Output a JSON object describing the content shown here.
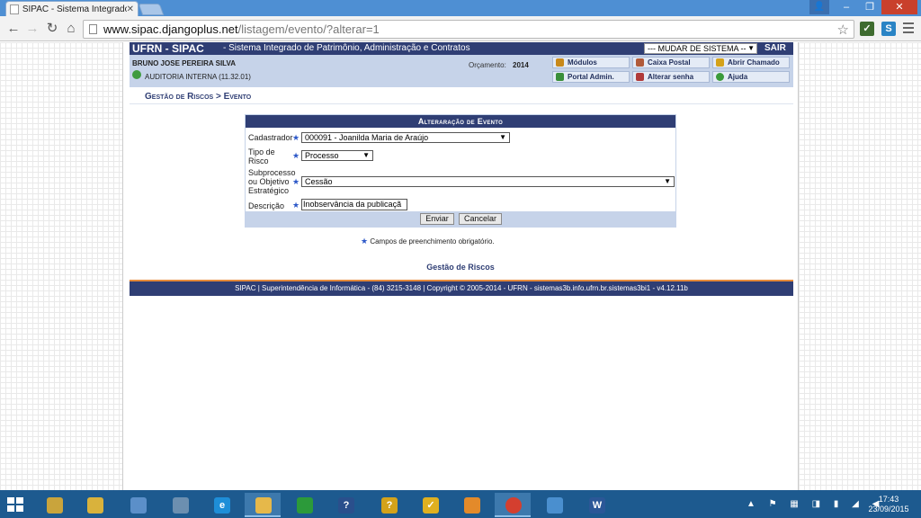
{
  "browser": {
    "tab_title": "SIPAC - Sistema Integrado",
    "url_host": "www.sipac.djangoplus.net",
    "url_path": "/listagem/evento/?alterar=1"
  },
  "header": {
    "logo": "UFRN - SIPAC",
    "system_name": "- Sistema Integrado de Patrimônio, Administração e Contratos",
    "system_select": "--- MUDAR DE SISTEMA --",
    "sair": "SAIR"
  },
  "user": {
    "name": "BRUNO JOSE PEREIRA SILVA",
    "unit": "AUDITORIA INTERNA (11.32.01)",
    "orcamento_label": "Orçamento:",
    "orcamento_value": "2014"
  },
  "quick_links": [
    {
      "label": "Módulos",
      "icon": "modules-icon",
      "color": "#c8891b"
    },
    {
      "label": "Caixa Postal",
      "icon": "mailbox-icon",
      "color": "#b05a3a"
    },
    {
      "label": "Abrir Chamado",
      "icon": "ticket-icon",
      "color": "#d4a21a"
    },
    {
      "label": "Portal Admin.",
      "icon": "portal-icon",
      "color": "#3a8f3a"
    },
    {
      "label": "Alterar senha",
      "icon": "key-icon",
      "color": "#b03a3a"
    },
    {
      "label": "Ajuda",
      "icon": "help-icon",
      "color": "#3a9a3a"
    }
  ],
  "breadcrumb": "Gestão de Riscos > Evento",
  "form": {
    "title": "Alteraração de Evento",
    "fields": {
      "cadastrador": {
        "label": "Cadastrador",
        "value": "000091 - Joanilda Maria de Araújo"
      },
      "tipo_risco": {
        "label1": "Tipo de",
        "label2": "Risco",
        "value": "Processo"
      },
      "subprocesso": {
        "label1": "Subprocesso",
        "label2": "ou Objetivo",
        "label3": "Estratégico",
        "value": "Cessão"
      },
      "descricao": {
        "label": "Descrição",
        "value": "Inobservância da publicaçã"
      }
    },
    "submit": "Enviar",
    "cancel": "Cancelar"
  },
  "required_marker": "★",
  "legend_text": "Campos de preenchimento obrigatório.",
  "module_link": "Gestão de Riscos",
  "footer": "SIPAC | Superintendência de Informática - (84) 3215-3148 | Copyright © 2005-2014 - UFRN - sistemas3b.info.ufrn.br.sistemas3bi1 - v4.12.11b",
  "clock": {
    "time": "17:43",
    "date": "23/09/2015"
  },
  "colors": {
    "navy": "#2f3e74",
    "light_blue": "#c6d3e9",
    "accent_orange": "#e58a3a"
  }
}
